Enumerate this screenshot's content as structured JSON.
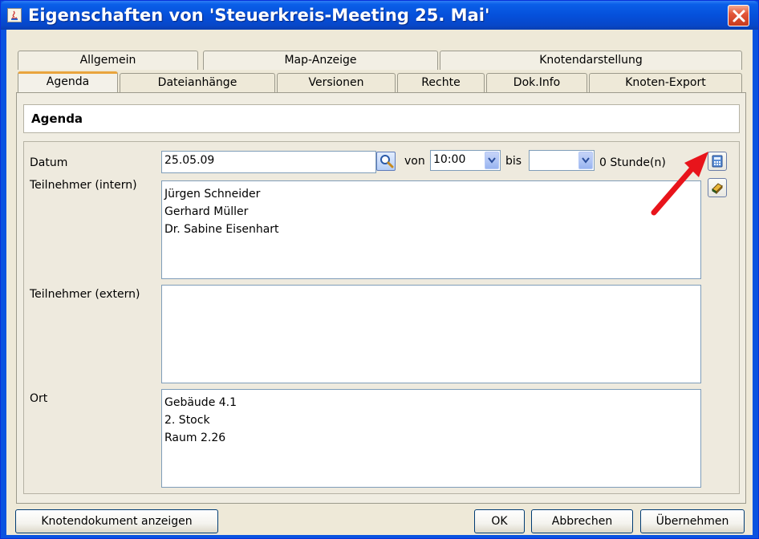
{
  "window": {
    "title": "Eigenschaften von 'Steuerkreis-Meeting 25. Mai'",
    "close_label": "close"
  },
  "tabs": {
    "back_row": [
      "Allgemein",
      "Map-Anzeige",
      "Knotendarstellung"
    ],
    "front_row": [
      "Agenda",
      "Dateianhänge",
      "Versionen",
      "Rechte",
      "Dok.Info",
      "Knoten-Export"
    ],
    "active": "Agenda"
  },
  "panel": {
    "header": "Agenda"
  },
  "form": {
    "datum_label": "Datum",
    "datum_value": "25.05.09",
    "von_label": "von",
    "von_value": "10:00",
    "bis_label": "bis",
    "bis_value": "",
    "duration": "0 Stunde(n)",
    "teilnehmer_intern_label": "Teilnehmer (intern)",
    "teilnehmer_intern": [
      "Jürgen Schneider",
      "Gerhard Müller",
      "Dr. Sabine Eisenhart"
    ],
    "teilnehmer_extern_label": "Teilnehmer (extern)",
    "teilnehmer_extern": [],
    "ort_label": "Ort",
    "ort": [
      "Gebäude 4.1",
      "2. Stock",
      "Raum 2.26"
    ]
  },
  "buttons": {
    "show_document": "Knotendokument anzeigen",
    "ok": "OK",
    "cancel": "Abbrechen",
    "apply": "Übernehmen"
  },
  "icons": {
    "title": "java-app-icon",
    "close": "close-icon",
    "search": "search-icon",
    "calculator": "calculator-icon",
    "agenda": "agenda-book-icon",
    "annotation": "red-arrow-annotation"
  },
  "colors": {
    "titlebar": "#0550DB",
    "dialog_bg": "#EEE9D8",
    "active_tab_accent": "#E9A43D",
    "annotation_arrow": "#E8141B"
  }
}
